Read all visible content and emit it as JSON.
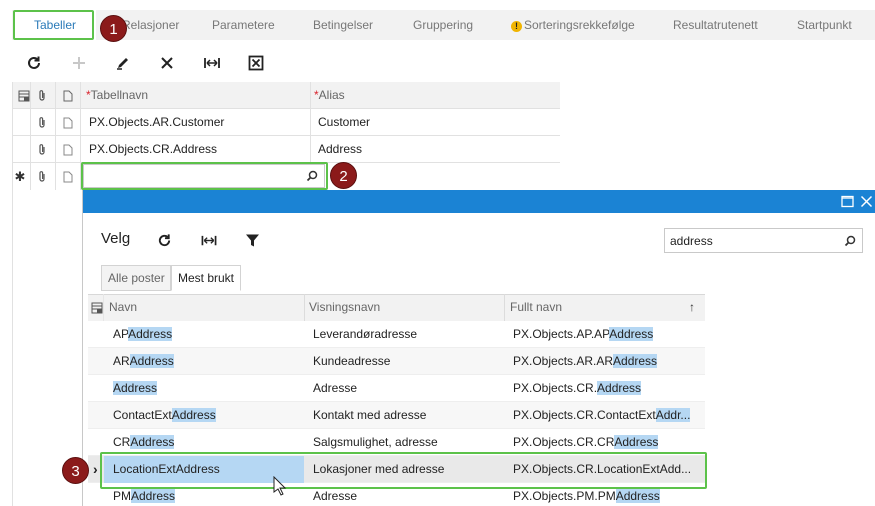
{
  "tabs": [
    {
      "label": "Tabeller",
      "active": true
    },
    {
      "label": "Relasjoner"
    },
    {
      "label": "Parametere"
    },
    {
      "label": "Betingelser"
    },
    {
      "label": "Gruppering"
    },
    {
      "label": "Sorteringsrekkefølge",
      "icon": "warning-icon"
    },
    {
      "label": "Resultatrutenett"
    },
    {
      "label": "Startpunkt"
    }
  ],
  "toolbar": {
    "icons": [
      "refresh-icon",
      "add-icon",
      "edit-icon",
      "delete-icon",
      "fit-columns-icon",
      "export-excel-icon"
    ]
  },
  "grid": {
    "columns": [
      {
        "label": "Tabellnavn",
        "required": "*"
      },
      {
        "label": "Alias",
        "required": "*"
      }
    ],
    "rows": [
      {
        "table": "PX.Objects.AR.Customer",
        "alias": "Customer"
      },
      {
        "table": "PX.Objects.CR.Address",
        "alias": "Address"
      }
    ],
    "new_row_marker": "✱",
    "input_value": ""
  },
  "steps": [
    "1",
    "2",
    "3"
  ],
  "lookup": {
    "select_label": "Velg",
    "search_value": "address",
    "subtabs": [
      "Alle poster",
      "Mest brukt"
    ],
    "active_subtab": "Mest brukt",
    "columns": [
      "Navn",
      "Visningsnavn",
      "Fullt navn"
    ],
    "sort_indicator": "↑",
    "rows": [
      {
        "name_pre": "AP",
        "name_hl": "Address",
        "display": "Leverandøradresse",
        "full_pre": "PX.Objects.AP.AP",
        "full_hl": "Address"
      },
      {
        "name_pre": "AR",
        "name_hl": "Address",
        "display": "Kundeadresse",
        "full_pre": "PX.Objects.AR.AR",
        "full_hl": "Address"
      },
      {
        "name_pre": "",
        "name_hl": "Address",
        "display": "Adresse",
        "full_pre": "PX.Objects.CR.",
        "full_hl": "Address"
      },
      {
        "name_pre": "ContactExt",
        "name_hl": "Address",
        "display": "Kontakt med adresse",
        "full_pre": "PX.Objects.CR.ContactExt",
        "full_hl": "Addr..."
      },
      {
        "name_pre": "CR",
        "name_hl": "Address",
        "display": "Salgsmulighet, adresse",
        "full_pre": "PX.Objects.CR.CR",
        "full_hl": "Address"
      },
      {
        "name_pre": "LocationExt",
        "name_hl": "Address",
        "display": "Lokasjoner med adresse",
        "full_pre": "PX.Objects.CR.LocationExtAdd...",
        "full_hl": ""
      },
      {
        "name_pre": "PM",
        "name_hl": "Address",
        "display": "Adresse",
        "full_pre": "PX.Objects.PM.PM",
        "full_hl": "Address"
      }
    ],
    "selected_row_marker": "›"
  },
  "colors": {
    "accent": "#2a7ab8",
    "annotation_green": "#5cc24a",
    "step_badge": "#8b1a1a",
    "panel_title": "#1b83d4",
    "highlight": "#b5d7f3"
  }
}
